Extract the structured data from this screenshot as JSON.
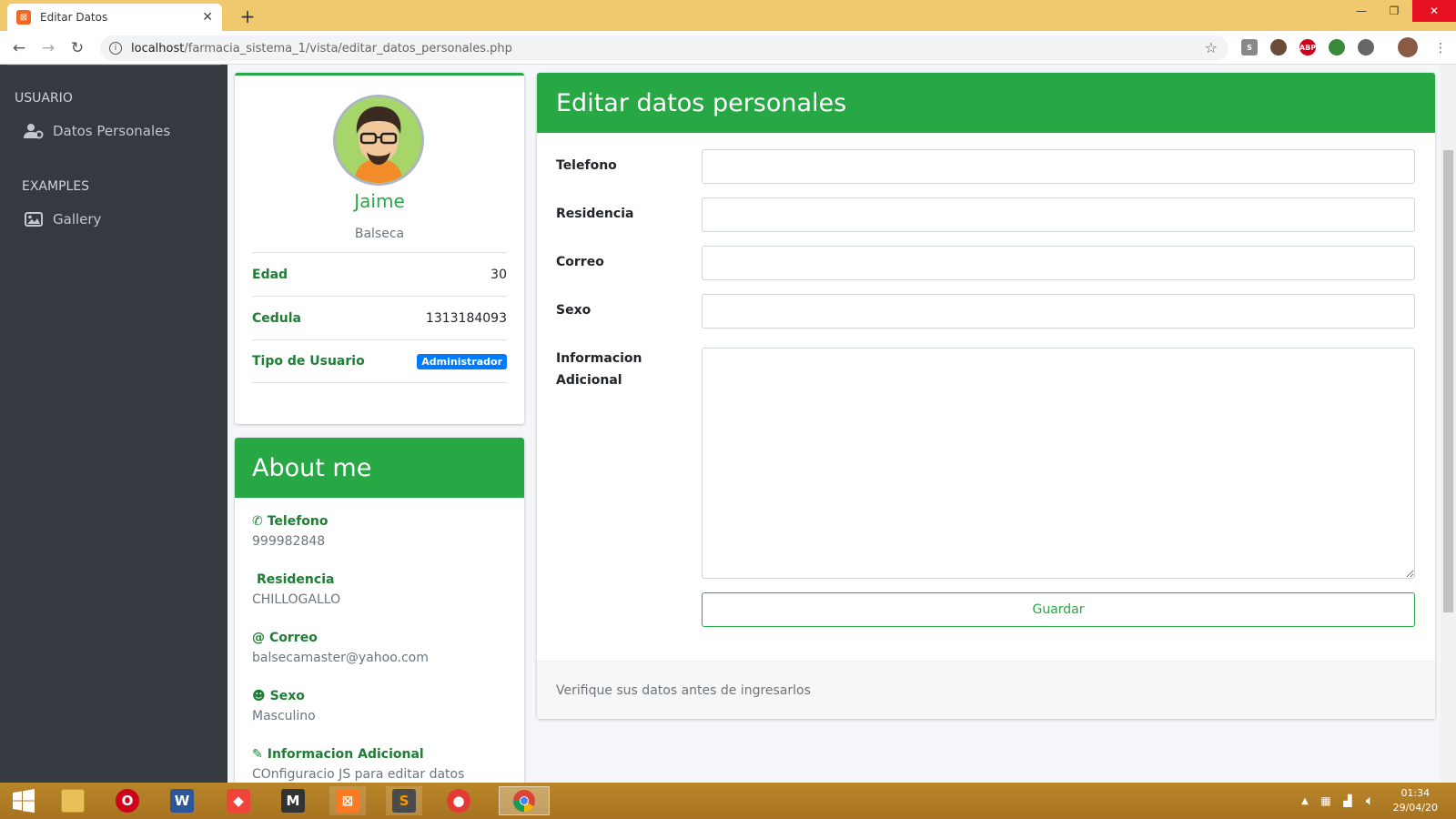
{
  "browser": {
    "tab_title": "Editar Datos",
    "url_host": "localhost",
    "url_path": "/farmacia_sistema_1/vista/editar_datos_personales.php"
  },
  "sidebar": {
    "sections": [
      {
        "header": "USUARIO",
        "items": [
          {
            "label": "Datos Personales",
            "icon": "user-cog-icon"
          }
        ]
      },
      {
        "header": "EXAMPLES",
        "items": [
          {
            "label": "Gallery",
            "icon": "image-icon"
          }
        ]
      }
    ]
  },
  "profile": {
    "name": "Jaime",
    "lastname": "Balseca",
    "rows": [
      {
        "label": "Edad",
        "value": "30"
      },
      {
        "label": "Cedula",
        "value": "1313184093"
      },
      {
        "label": "Tipo de Usuario",
        "value": "Administrador"
      }
    ]
  },
  "about": {
    "title": "About me",
    "items": [
      {
        "label": "Telefono",
        "value": "999982848",
        "icon": "phone-icon"
      },
      {
        "label": "Residencia",
        "value": "CHILLOGALLO",
        "icon": "map-marker-icon"
      },
      {
        "label": "Correo",
        "value": "balsecamaster@yahoo.com",
        "icon": "at-icon"
      },
      {
        "label": "Sexo",
        "value": "Masculino",
        "icon": "smile-icon"
      },
      {
        "label": "Informacion Adicional",
        "value": "COnfiguracio JS para editar datos",
        "icon": "pencil-icon"
      }
    ]
  },
  "form": {
    "title": "Editar datos personales",
    "fields": [
      {
        "label": "Telefono",
        "value": ""
      },
      {
        "label": "Residencia",
        "value": ""
      },
      {
        "label": "Correo",
        "value": ""
      },
      {
        "label": "Sexo",
        "value": ""
      }
    ],
    "textarea_label_1": "Informacion",
    "textarea_label_2": "Adicional",
    "submit_label": "Guardar",
    "footer": "Verifique sus datos antes de ingresarlos"
  },
  "taskbar": {
    "time": "01:34",
    "date": "29/04/20"
  },
  "colors": {
    "accent": "#28a745",
    "sidebar": "#343a40",
    "badge": "#007bff"
  }
}
